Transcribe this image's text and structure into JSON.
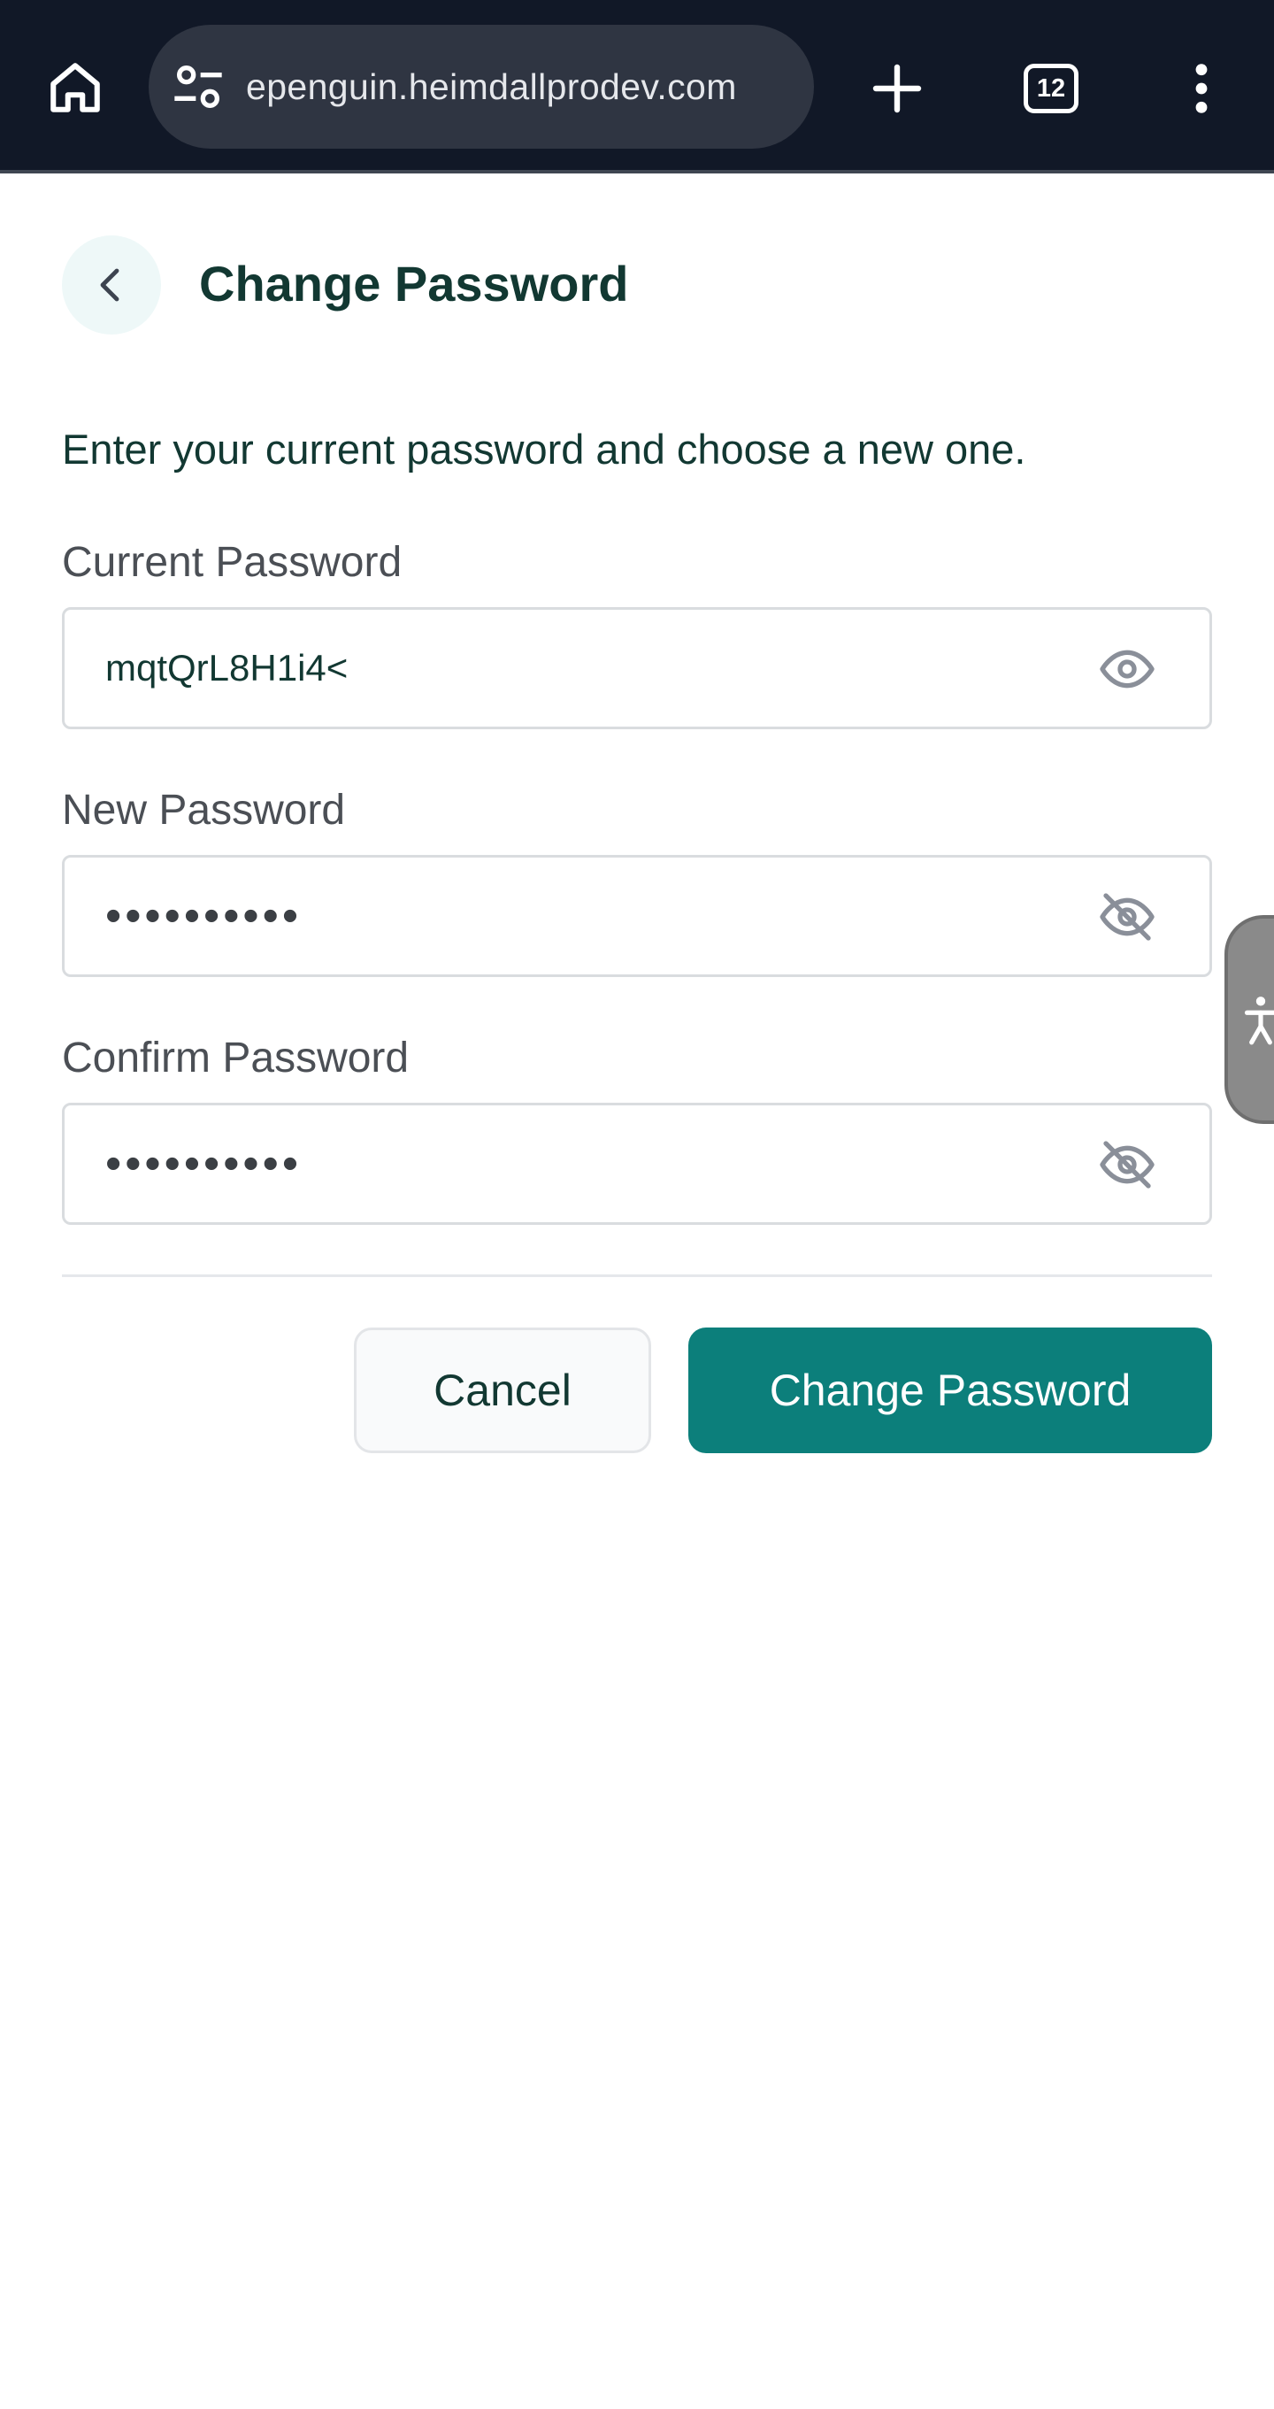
{
  "browser": {
    "url": "epenguin.heimdallprodev.com",
    "tab_count": "12"
  },
  "header": {
    "title": "Change Password"
  },
  "intro": "Enter your current password and choose a new one.",
  "fields": {
    "current": {
      "label": "Current Password",
      "value": "mqtQrL8H1i4<",
      "visible": true
    },
    "new": {
      "label": "New Password",
      "value": "••••••••••",
      "visible": false
    },
    "confirm": {
      "label": "Confirm Password",
      "value": "••••••••••",
      "visible": false
    }
  },
  "actions": {
    "cancel_label": "Cancel",
    "submit_label": "Change Password"
  },
  "colors": {
    "primary": "#0c7f7b",
    "title_text": "#123832",
    "browser_bar": "#111827"
  },
  "icons": {
    "home": "home-icon",
    "site_settings": "site-settings-icon",
    "new_tab": "plus-icon",
    "tabs": "tab-switcher-icon",
    "menu": "more-vertical-icon",
    "back": "chevron-left-icon",
    "show_password": "eye-icon",
    "hide_password": "eye-off-icon",
    "accessibility": "accessibility-icon"
  }
}
